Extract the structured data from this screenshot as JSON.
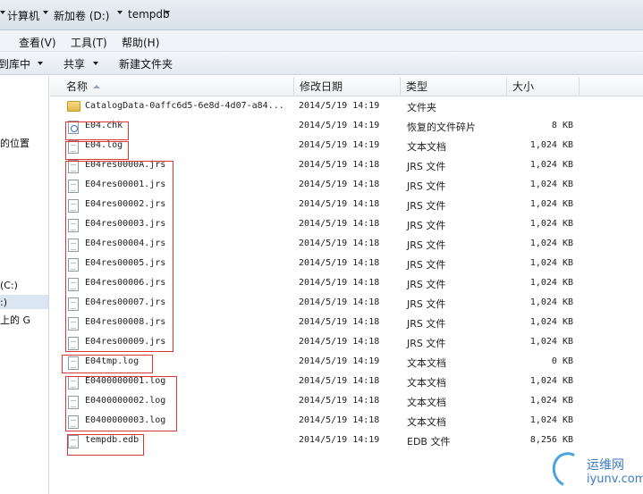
{
  "address": {
    "crumbs": [
      "计算机",
      "新加卷 (D:)",
      "tempdb"
    ]
  },
  "menu": {
    "items": [
      "查看(V)",
      "工具(T)",
      "帮助(H)"
    ]
  },
  "toolbar": {
    "items": [
      "到库中",
      "共享",
      "新建文件夹"
    ]
  },
  "nav": {
    "items": [
      "的位置",
      "(C:)",
      ":)",
      "上的 G"
    ]
  },
  "columns": {
    "name": "名称",
    "date": "修改日期",
    "type": "类型",
    "size": "大小"
  },
  "files": [
    {
      "icon": "folder-icon",
      "name": "CatalogData-0affc6d5-6e8d-4d07-a84...",
      "date": "2014/5/19 14:19",
      "type": "文件夹",
      "size": ""
    },
    {
      "icon": "chk-file-icon",
      "name": "E04.chk",
      "date": "2014/5/19 14:19",
      "type": "恢复的文件碎片",
      "size": "8 KB"
    },
    {
      "icon": "text-file-icon",
      "name": "E04.log",
      "date": "2014/5/19 14:19",
      "type": "文本文档",
      "size": "1,024 KB"
    },
    {
      "icon": "file-icon",
      "name": "E04res0000A.jrs",
      "date": "2014/5/19 14:18",
      "type": "JRS 文件",
      "size": "1,024 KB"
    },
    {
      "icon": "file-icon",
      "name": "E04res00001.jrs",
      "date": "2014/5/19 14:18",
      "type": "JRS 文件",
      "size": "1,024 KB"
    },
    {
      "icon": "file-icon",
      "name": "E04res00002.jrs",
      "date": "2014/5/19 14:18",
      "type": "JRS 文件",
      "size": "1,024 KB"
    },
    {
      "icon": "file-icon",
      "name": "E04res00003.jrs",
      "date": "2014/5/19 14:18",
      "type": "JRS 文件",
      "size": "1,024 KB"
    },
    {
      "icon": "file-icon",
      "name": "E04res00004.jrs",
      "date": "2014/5/19 14:18",
      "type": "JRS 文件",
      "size": "1,024 KB"
    },
    {
      "icon": "file-icon",
      "name": "E04res00005.jrs",
      "date": "2014/5/19 14:18",
      "type": "JRS 文件",
      "size": "1,024 KB"
    },
    {
      "icon": "file-icon",
      "name": "E04res00006.jrs",
      "date": "2014/5/19 14:18",
      "type": "JRS 文件",
      "size": "1,024 KB"
    },
    {
      "icon": "file-icon",
      "name": "E04res00007.jrs",
      "date": "2014/5/19 14:18",
      "type": "JRS 文件",
      "size": "1,024 KB"
    },
    {
      "icon": "file-icon",
      "name": "E04res00008.jrs",
      "date": "2014/5/19 14:18",
      "type": "JRS 文件",
      "size": "1,024 KB"
    },
    {
      "icon": "file-icon",
      "name": "E04res00009.jrs",
      "date": "2014/5/19 14:18",
      "type": "JRS 文件",
      "size": "1,024 KB"
    },
    {
      "icon": "text-file-icon",
      "name": "E04tmp.log",
      "date": "2014/5/19 14:19",
      "type": "文本文档",
      "size": "0 KB"
    },
    {
      "icon": "text-file-icon",
      "name": "E0400000001.log",
      "date": "2014/5/19 14:18",
      "type": "文本文档",
      "size": "1,024 KB"
    },
    {
      "icon": "text-file-icon",
      "name": "E0400000002.log",
      "date": "2014/5/19 14:18",
      "type": "文本文档",
      "size": "1,024 KB"
    },
    {
      "icon": "text-file-icon",
      "name": "E0400000003.log",
      "date": "2014/5/19 14:18",
      "type": "文本文档",
      "size": "1,024 KB"
    },
    {
      "icon": "file-icon",
      "name": "tempdb.edb",
      "date": "2014/5/19 14:19",
      "type": "EDB 文件",
      "size": "8,256 KB"
    }
  ],
  "watermark": {
    "line1": "运维网",
    "line2": "iyunv.com"
  }
}
